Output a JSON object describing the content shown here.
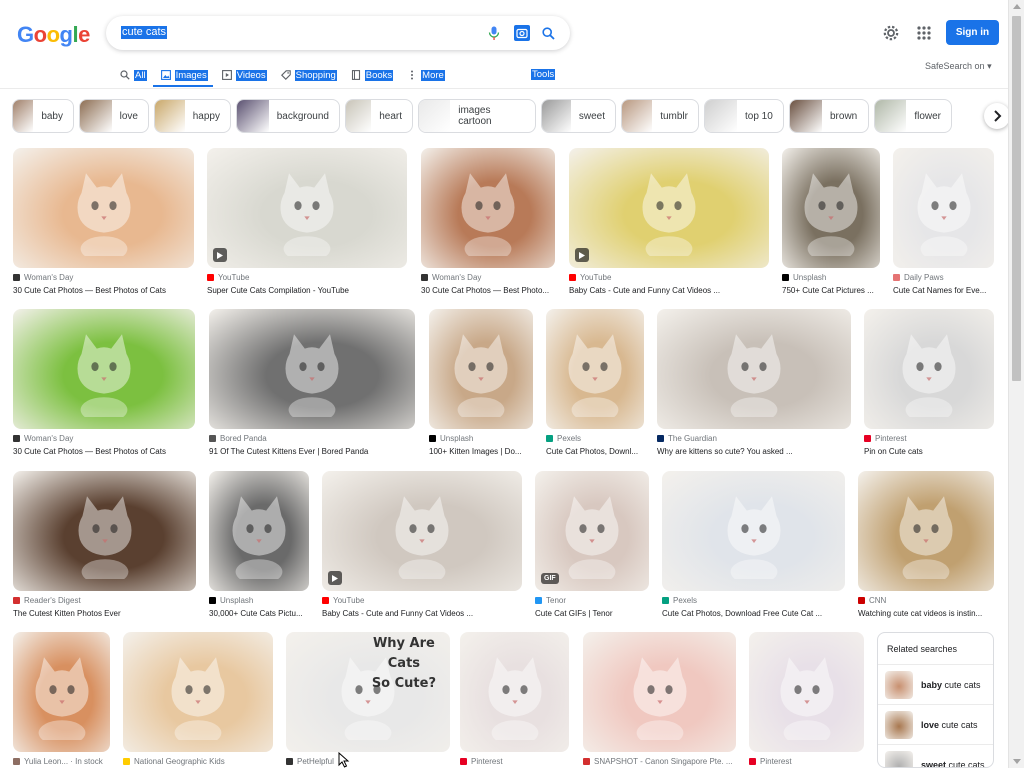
{
  "logo": {
    "letters": [
      "G",
      "o",
      "o",
      "g",
      "l",
      "e"
    ]
  },
  "search": {
    "query": "cute cats"
  },
  "header": {
    "signin_label": "Sign in",
    "safesearch": "SafeSearch on"
  },
  "tabs": [
    {
      "label": "All",
      "icon": "search-icon"
    },
    {
      "label": "Images",
      "icon": "image-icon"
    },
    {
      "label": "Videos",
      "icon": "video-icon"
    },
    {
      "label": "Shopping",
      "icon": "tag-icon"
    },
    {
      "label": "Books",
      "icon": "book-icon"
    },
    {
      "label": "More",
      "icon": "more-vert-icon"
    }
  ],
  "tools_label": "Tools",
  "chips": [
    {
      "label": "baby",
      "color": "#a0806a"
    },
    {
      "label": "love",
      "color": "#8d6e53"
    },
    {
      "label": "happy",
      "color": "#c9a86a"
    },
    {
      "label": "background",
      "color": "#5a5070"
    },
    {
      "label": "heart",
      "color": "#c8c4b8"
    },
    {
      "label": "images cartoon",
      "color": "#e9e9e9"
    },
    {
      "label": "sweet",
      "color": "#9a9a9a"
    },
    {
      "label": "tumblr",
      "color": "#b89880"
    },
    {
      "label": "top 10",
      "color": "#cfcfcf"
    },
    {
      "label": "brown",
      "color": "#6a5040"
    },
    {
      "label": "flower",
      "color": "#b0b8a8"
    }
  ],
  "results": [
    {
      "source": "Woman's Day",
      "title": "30 Cute Cat Photos — Best Photos of Cats",
      "fav": "#333333",
      "color": "#e8b890",
      "play": false,
      "gif": false
    },
    {
      "source": "YouTube",
      "title": "Super Cute Cats Compilation - YouTube",
      "fav": "#ff0000",
      "color": "#d8d8d0",
      "play": true,
      "gif": false
    },
    {
      "source": "Woman's Day",
      "title": "30 Cute Cat Photos — Best Photo...",
      "fav": "#333333",
      "color": "#b87a58",
      "play": false,
      "gif": false
    },
    {
      "source": "YouTube",
      "title": "Baby Cats - Cute and Funny Cat Videos ...",
      "fav": "#ff0000",
      "color": "#e0d070",
      "play": true,
      "gif": false
    },
    {
      "source": "Unsplash",
      "title": "750+ Cute Cat Pictures ...",
      "fav": "#000000",
      "color": "#7a7060",
      "play": false,
      "gif": false
    },
    {
      "source": "Daily Paws",
      "title": "Cute Cat Names for Eve...",
      "fav": "#e57373",
      "color": "#e6e6e8",
      "play": false,
      "gif": false
    },
    {
      "source": "Woman's Day",
      "title": "30 Cute Cat Photos — Best Photos of Cats",
      "fav": "#333333",
      "color": "#7cc040",
      "play": false,
      "gif": false
    },
    {
      "source": "Bored Panda",
      "title": "91 Of The Cutest Kittens Ever | Bored Panda",
      "fav": "#555555",
      "color": "#707070",
      "play": false,
      "gif": false
    },
    {
      "source": "Unsplash",
      "title": "100+ Kitten Images | Do...",
      "fav": "#000000",
      "color": "#c8a888",
      "play": false,
      "gif": false
    },
    {
      "source": "Pexels",
      "title": "Cute Cat Photos, Downl...",
      "fav": "#05a081",
      "color": "#d8b890",
      "play": false,
      "gif": false
    },
    {
      "source": "The Guardian",
      "title": "Why are kittens so cute? You asked ...",
      "fav": "#052962",
      "color": "#c8c0b8",
      "play": false,
      "gif": false
    },
    {
      "source": "Pinterest",
      "title": "Pin on Cute cats",
      "fav": "#e60023",
      "color": "#d8d8d8",
      "play": false,
      "gif": false
    },
    {
      "source": "Reader's Digest",
      "title": "The Cutest Kitten Photos Ever",
      "fav": "#d32f2f",
      "color": "#5a4030",
      "play": false,
      "gif": false
    },
    {
      "source": "Unsplash",
      "title": "30,000+ Cute Cats Pictu...",
      "fav": "#000000",
      "color": "#6a6a6a",
      "play": false,
      "gif": false
    },
    {
      "source": "YouTube",
      "title": "Baby Cats - Cute and Funny Cat Videos ...",
      "fav": "#ff0000",
      "color": "#d0c8c0",
      "play": true,
      "gif": false
    },
    {
      "source": "Tenor",
      "title": "Cute Cat GIFs | Tenor",
      "fav": "#2196f3",
      "color": "#d8c8c0",
      "play": false,
      "gif": true
    },
    {
      "source": "Pexels",
      "title": "Cute Cat Photos, Download Free Cute Cat ...",
      "fav": "#05a081",
      "color": "#e0e4ea",
      "play": false,
      "gif": false
    },
    {
      "source": "CNN",
      "title": "Watching cute cat videos is instin...",
      "fav": "#cc0000",
      "color": "#c0a070",
      "play": false,
      "gif": false
    },
    {
      "source": "Yulia Leon... · In stock",
      "title": "",
      "fav": "#8d6e63",
      "color": "#d89060",
      "play": false,
      "gif": false
    },
    {
      "source": "National Geographic Kids",
      "title": "",
      "fav": "#ffcc00",
      "color": "#e8c8a0",
      "play": false,
      "gif": false
    },
    {
      "source": "PetHelpful",
      "title": "",
      "fav": "#333333",
      "color": "#e8e8e8",
      "play": false,
      "gif": false
    },
    {
      "source": "Pinterest",
      "title": "",
      "fav": "#e60023",
      "color": "#e8e0e0",
      "play": false,
      "gif": false
    },
    {
      "source": "SNAPSHOT - Canon Singapore Pte. ...",
      "title": "",
      "fav": "#d32f2f",
      "color": "#f0c8c0",
      "play": false,
      "gif": false
    },
    {
      "source": "Pinterest",
      "title": "",
      "fav": "#e60023",
      "color": "#e8e0e8",
      "play": false,
      "gif": false
    }
  ],
  "poster_text": [
    "Why Are",
    "Cats",
    "So Cute?"
  ],
  "related": {
    "title": "Related searches",
    "items": [
      {
        "bold": "baby",
        "rest": " cute cats",
        "color": "#c89070"
      },
      {
        "bold": "love",
        "rest": " cute cats",
        "color": "#a87850"
      },
      {
        "bold": "sweet",
        "rest": " cute cats",
        "color": "#b0b0b0"
      }
    ]
  }
}
